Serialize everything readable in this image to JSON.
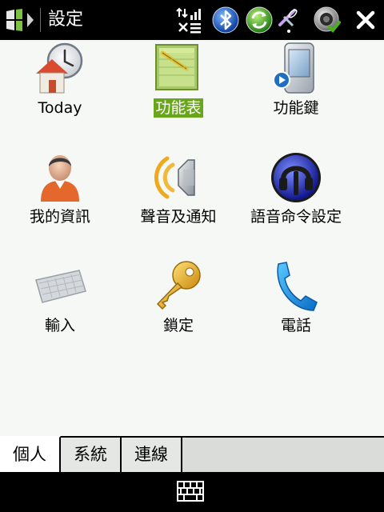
{
  "title_bar": {
    "title": "設定"
  },
  "icons": {
    "start": "windows-flag-icon",
    "network": "network-signal-icon",
    "bluetooth": "bluetooth-icon",
    "sync": "activesync-icon",
    "signal": "phone-signal-icon",
    "volume": "speaker-volume-icon",
    "close": "close-icon",
    "keyboard_toggle": "keyboard-icon"
  },
  "items": [
    {
      "label": "Today",
      "icon": "today-clock-house-icon"
    },
    {
      "label": "功能表",
      "icon": "menu-folder-icon",
      "selected": true
    },
    {
      "label": "功能鍵",
      "icon": "device-buttons-icon"
    },
    {
      "label": "我的資訊",
      "icon": "owner-info-person-icon"
    },
    {
      "label": "聲音及通知",
      "icon": "speaker-sound-icon"
    },
    {
      "label": "語音命令設定",
      "icon": "voice-command-icon"
    },
    {
      "label": "輸入",
      "icon": "input-keyboard-icon"
    },
    {
      "label": "鎖定",
      "icon": "lock-key-icon"
    },
    {
      "label": "電話",
      "icon": "phone-handset-icon"
    }
  ],
  "tabs": [
    {
      "label": "個人",
      "active": true
    },
    {
      "label": "系統",
      "active": false
    },
    {
      "label": "連線",
      "active": false
    }
  ],
  "colors": {
    "selection_green": "#6aa61c",
    "background": "#f6f8f6",
    "bar_black": "#000000"
  }
}
